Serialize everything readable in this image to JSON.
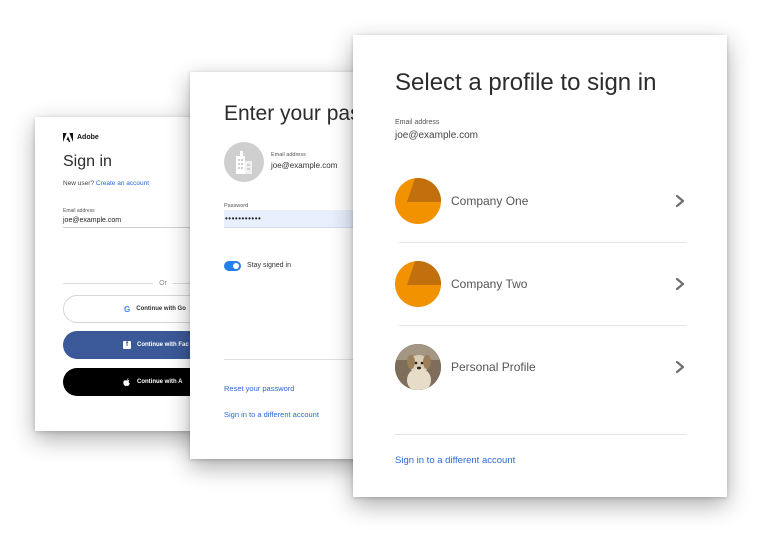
{
  "signin_card": {
    "brand": "Adobe",
    "title": "Sign in",
    "new_user_prefix": "New user?",
    "create_account_link": "Create an account",
    "email_label": "Email address",
    "email_value": "joe@example.com",
    "or_separator": "Or",
    "google_button": "Continue with Go",
    "facebook_button": "Continue with Fac",
    "apple_button": "Continue with A"
  },
  "password_card": {
    "title": "Enter your pas",
    "email_label": "Email address",
    "email_value": "joe@example.com",
    "password_label": "Password",
    "password_value": "•••••••••••",
    "stay_signed_in_label": "Stay signed in",
    "stay_signed_in": true,
    "reset_password_link": "Reset your password",
    "different_account_link": "Sign in to a different account"
  },
  "profile_card": {
    "title": "Select a profile to sign in",
    "email_label": "Email address",
    "email_value": "joe@example.com",
    "profiles": [
      {
        "name": "Company One",
        "avatar": "orange-company-avatar"
      },
      {
        "name": "Company Two",
        "avatar": "orange-company-avatar"
      },
      {
        "name": "Personal Profile",
        "avatar": "dog-photo-avatar"
      }
    ],
    "different_account_link": "Sign in to a different account"
  },
  "colors": {
    "link_blue": "#2b68d6",
    "toggle_blue": "#2680eb",
    "facebook_blue": "#3b5998",
    "company_orange": "#f39200",
    "password_field_bg": "#e8f0fd"
  }
}
